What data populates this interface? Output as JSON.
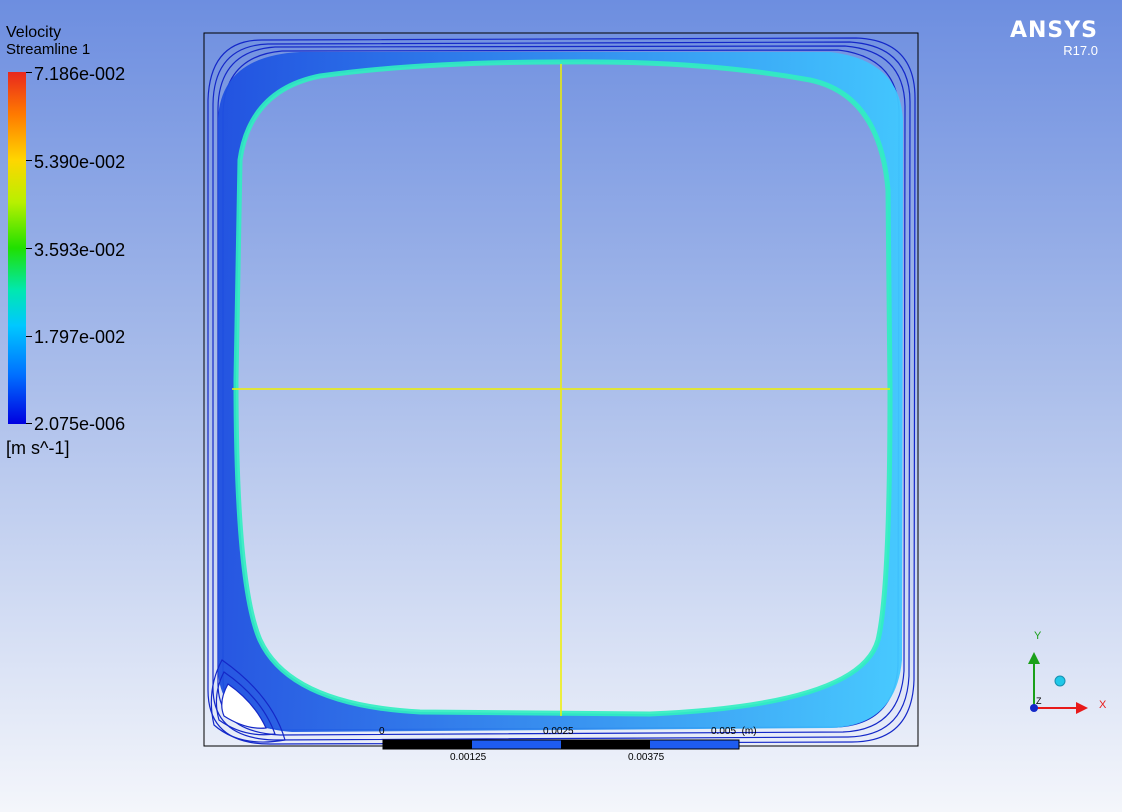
{
  "legend": {
    "title": "Velocity",
    "subtitle": "Streamline 1",
    "ticks": [
      "7.186e-002",
      "5.390e-002",
      "3.593e-002",
      "1.797e-002",
      "2.075e-006"
    ],
    "units": "[m s^-1]"
  },
  "brand": {
    "name": "ANSYS",
    "version": "R17.0"
  },
  "scale": {
    "top_labels": [
      "0",
      "0.0025",
      "0.005  (m)"
    ],
    "bottom_labels": [
      "0.00125",
      "0.00375"
    ]
  },
  "axes_triad": {
    "y_label": "Y",
    "x_label": "X",
    "z_label": "Z"
  },
  "colors": {
    "background_top": "#6d8ee0",
    "background_bottom": "#f4f6fb",
    "streamline_dark": "#1428c8",
    "streamline_core": "#30f0c0",
    "probe_lines": "#f0f000"
  }
}
